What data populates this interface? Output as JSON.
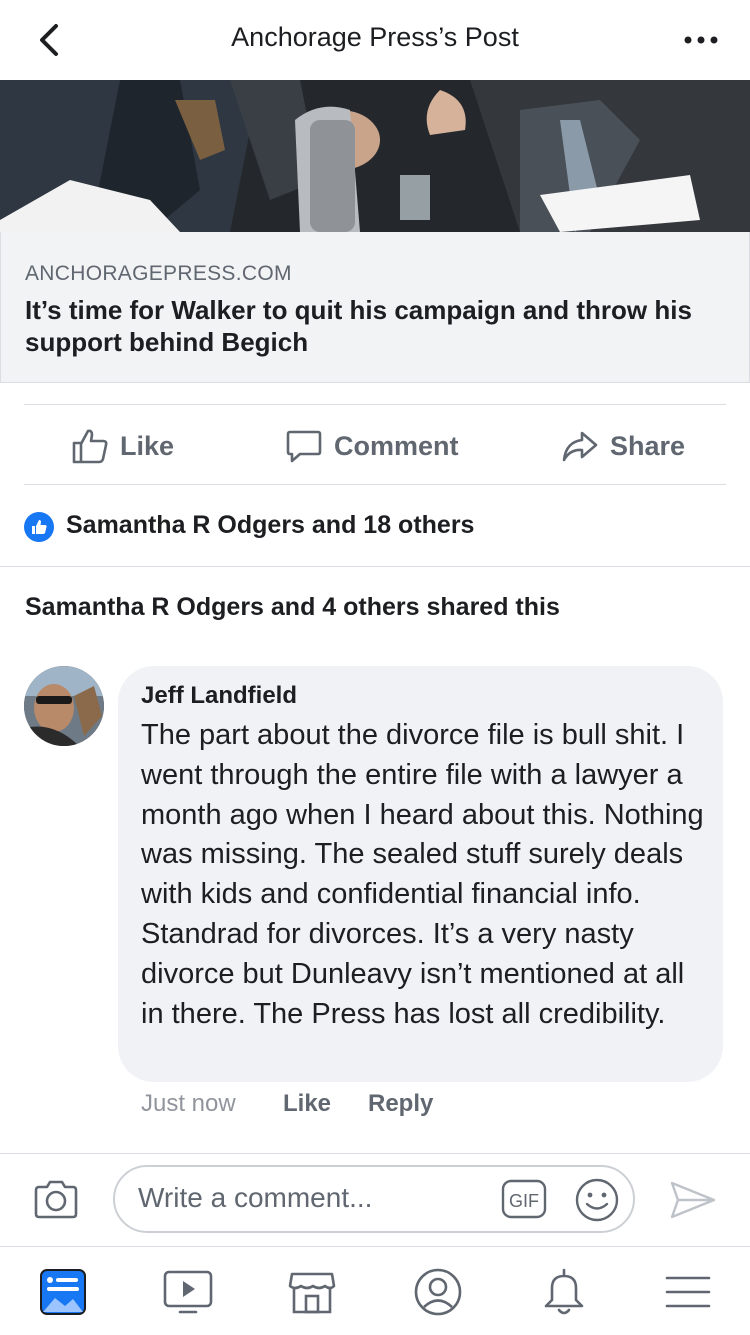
{
  "header": {
    "title": "Anchorage Press’s Post",
    "back_icon": "chevron-left-icon",
    "more_icon": "ellipsis-icon"
  },
  "link_preview": {
    "domain": "ANCHORAGEPRESS.COM",
    "headline": "It’s time for Walker to quit his campaign and throw his support behind Begich"
  },
  "actions": {
    "like": "Like",
    "comment": "Comment",
    "share": "Share"
  },
  "reactions": {
    "likes_text": "Samantha R Odgers and 18 others"
  },
  "shares": {
    "text": "Samantha R Odgers and 4 others shared this"
  },
  "comment": {
    "author": "Jeff Landfield",
    "text": "The part about the divorce file is bull shit. I went through the entire file with a lawyer a month ago when I heard about this. Nothing was missing. The sealed stuff surely deals with kids and confidential financial info. Standrad for divorces. It’s a very nasty divorce but Dunleavy isn’t mentioned at all in there. The Press has lost all credibility.",
    "time": "Just now",
    "like": "Like",
    "reply": "Reply"
  },
  "composer": {
    "placeholder": "Write a comment...",
    "gif_label": "GIF"
  },
  "colors": {
    "accent": "#1877f2",
    "text": "#1c1e21",
    "secondary": "#606770",
    "bubble": "#f0f2f5"
  },
  "bottom_nav": [
    "news-feed-icon",
    "watch-icon",
    "marketplace-icon",
    "profile-icon",
    "notifications-icon",
    "menu-icon"
  ]
}
